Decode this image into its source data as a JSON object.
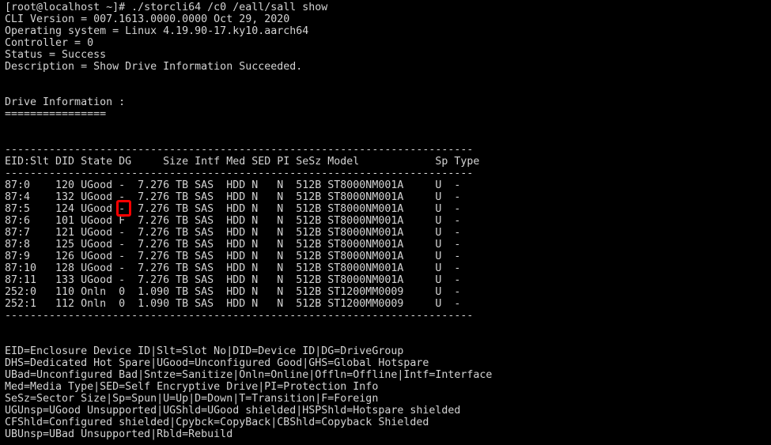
{
  "terminal": {
    "prompt_line": "[root@localhost ~]# ./storcli64 /c0 /eall/sall show",
    "header_lines": [
      "CLI Version = 007.1613.0000.0000 Oct 29, 2020",
      "Operating system = Linux 4.19.90-17.ky10.aarch64",
      "Controller = 0",
      "Status = Success",
      "Description = Show Drive Information Succeeded."
    ],
    "section_title": "Drive Information :",
    "section_underline": "================",
    "table": {
      "separator": "--------------------------------------------------------------------------",
      "header": "EID:Slt DID State DG     Size Intf Med SED PI SeSz Model            Sp Type",
      "columns": [
        "EID:Slt",
        "DID",
        "State",
        "DG",
        "Size",
        "Intf",
        "Med",
        "SED",
        "PI",
        "SeSz",
        "Model",
        "Sp",
        "Type"
      ],
      "rows": [
        "87:0    120 UGood -  7.276 TB SAS  HDD N   N  512B ST8000NM001A     U  -",
        "87:4    132 UGood -  7.276 TB SAS  HDD N   N  512B ST8000NM001A     U  -",
        "87:5    124 UGood -  7.276 TB SAS  HDD N   N  512B ST8000NM001A     U  -",
        "87:6    101 UGood F  7.276 TB SAS  HDD N   N  512B ST8000NM001A     U  -",
        "87:7    121 UGood -  7.276 TB SAS  HDD N   N  512B ST8000NM001A     U  -",
        "87:8    125 UGood -  7.276 TB SAS  HDD N   N  512B ST8000NM001A     U  -",
        "87:9    126 UGood -  7.276 TB SAS  HDD N   N  512B ST8000NM001A     U  -",
        "87:10   128 UGood -  7.276 TB SAS  HDD N   N  512B ST8000NM001A     U  -",
        "87:11   133 UGood -  7.276 TB SAS  HDD N   N  512B ST8000NM001A     U  -",
        "252:0   110 Onln  0  1.090 TB SAS  HDD N   N  512B ST1200MM0009     U  -",
        "252:1   112 Onln  0  1.090 TB SAS  HDD N   N  512B ST1200MM0009     U  -"
      ],
      "row_data": [
        {
          "eid_slt": "87:0",
          "did": "120",
          "state": "UGood",
          "dg": "-",
          "size": "7.276 TB",
          "intf": "SAS",
          "med": "HDD",
          "sed": "N",
          "pi": "N",
          "sesz": "512B",
          "model": "ST8000NM001A",
          "sp": "U",
          "type": "-"
        },
        {
          "eid_slt": "87:4",
          "did": "132",
          "state": "UGood",
          "dg": "-",
          "size": "7.276 TB",
          "intf": "SAS",
          "med": "HDD",
          "sed": "N",
          "pi": "N",
          "sesz": "512B",
          "model": "ST8000NM001A",
          "sp": "U",
          "type": "-"
        },
        {
          "eid_slt": "87:5",
          "did": "124",
          "state": "UGood",
          "dg": "-",
          "size": "7.276 TB",
          "intf": "SAS",
          "med": "HDD",
          "sed": "N",
          "pi": "N",
          "sesz": "512B",
          "model": "ST8000NM001A",
          "sp": "U",
          "type": "-"
        },
        {
          "eid_slt": "87:6",
          "did": "101",
          "state": "UGood",
          "dg": "F",
          "size": "7.276 TB",
          "intf": "SAS",
          "med": "HDD",
          "sed": "N",
          "pi": "N",
          "sesz": "512B",
          "model": "ST8000NM001A",
          "sp": "U",
          "type": "-"
        },
        {
          "eid_slt": "87:7",
          "did": "121",
          "state": "UGood",
          "dg": "-",
          "size": "7.276 TB",
          "intf": "SAS",
          "med": "HDD",
          "sed": "N",
          "pi": "N",
          "sesz": "512B",
          "model": "ST8000NM001A",
          "sp": "U",
          "type": "-"
        },
        {
          "eid_slt": "87:8",
          "did": "125",
          "state": "UGood",
          "dg": "-",
          "size": "7.276 TB",
          "intf": "SAS",
          "med": "HDD",
          "sed": "N",
          "pi": "N",
          "sesz": "512B",
          "model": "ST8000NM001A",
          "sp": "U",
          "type": "-"
        },
        {
          "eid_slt": "87:9",
          "did": "126",
          "state": "UGood",
          "dg": "-",
          "size": "7.276 TB",
          "intf": "SAS",
          "med": "HDD",
          "sed": "N",
          "pi": "N",
          "sesz": "512B",
          "model": "ST8000NM001A",
          "sp": "U",
          "type": "-"
        },
        {
          "eid_slt": "87:10",
          "did": "128",
          "state": "UGood",
          "dg": "-",
          "size": "7.276 TB",
          "intf": "SAS",
          "med": "HDD",
          "sed": "N",
          "pi": "N",
          "sesz": "512B",
          "model": "ST8000NM001A",
          "sp": "U",
          "type": "-"
        },
        {
          "eid_slt": "87:11",
          "did": "133",
          "state": "UGood",
          "dg": "-",
          "size": "7.276 TB",
          "intf": "SAS",
          "med": "HDD",
          "sed": "N",
          "pi": "N",
          "sesz": "512B",
          "model": "ST8000NM001A",
          "sp": "U",
          "type": "-"
        },
        {
          "eid_slt": "252:0",
          "did": "110",
          "state": "Onln",
          "dg": "0",
          "size": "1.090 TB",
          "intf": "SAS",
          "med": "HDD",
          "sed": "N",
          "pi": "N",
          "sesz": "512B",
          "model": "ST1200MM0009",
          "sp": "U",
          "type": "-"
        },
        {
          "eid_slt": "252:1",
          "did": "112",
          "state": "Onln",
          "dg": "0",
          "size": "1.090 TB",
          "intf": "SAS",
          "med": "HDD",
          "sed": "N",
          "pi": "N",
          "sesz": "512B",
          "model": "ST1200MM0009",
          "sp": "U",
          "type": "-"
        }
      ]
    },
    "legend_lines": [
      "EID=Enclosure Device ID|Slt=Slot No|DID=Device ID|DG=DriveGroup",
      "DHS=Dedicated Hot Spare|UGood=Unconfigured Good|GHS=Global Hotspare",
      "UBad=Unconfigured Bad|Sntze=Sanitize|Onln=Online|Offln=Offline|Intf=Interface",
      "Med=Media Type|SED=Self Encryptive Drive|PI=Protection Info",
      "SeSz=Sector Size|Sp=Spun|U=Up|D=Down|T=Transition|F=Foreign",
      "UGUnsp=UGood Unsupported|UGShld=UGood shielded|HSPShld=Hotspare shielded",
      "CFShld=Configured shielded|Cpybck=CopyBack|CBShld=Copyback Shielded",
      "UBUnsp=UBad Unsupported|Rbld=Rebuild"
    ],
    "highlight": {
      "label": "F",
      "color": "#ff0000",
      "row": "87:6",
      "column": "DG"
    },
    "colors": {
      "background": "#000000",
      "foreground": "#d4d4d4",
      "highlight": "#ff0000"
    }
  }
}
